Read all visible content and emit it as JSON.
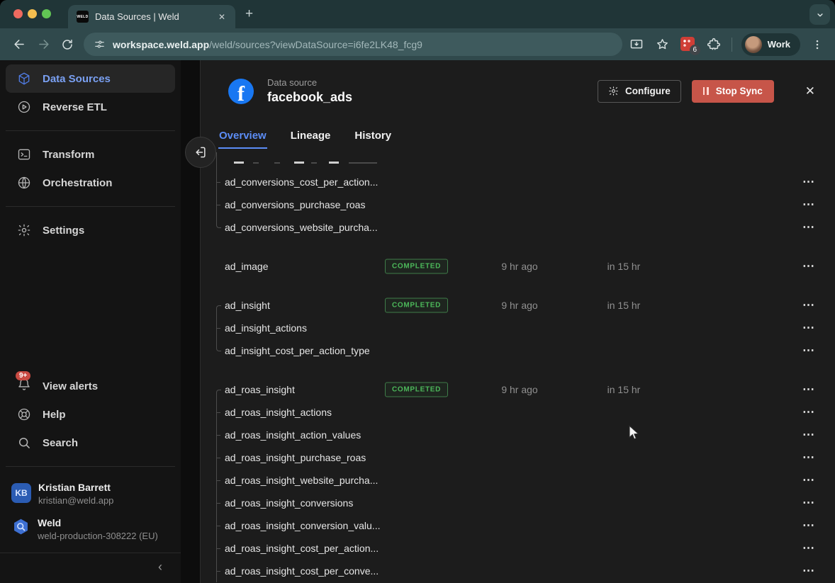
{
  "browser": {
    "tab": {
      "title": "Data Sources | Weld",
      "favicon": "WELD"
    },
    "url": {
      "host": "workspace.weld.app",
      "path": "/weld/sources?viewDataSource=i6fe2LK48_fcg9"
    },
    "profile": {
      "label": "Work"
    },
    "extension_badge": "6"
  },
  "sidebar": {
    "nav": [
      {
        "label": "Data Sources",
        "icon": "cube-icon",
        "active": true
      },
      {
        "label": "Reverse ETL",
        "icon": "play-circle-icon"
      },
      {
        "label": "Transform",
        "icon": "terminal-icon"
      },
      {
        "label": "Orchestration",
        "icon": "globe-icon"
      },
      {
        "label": "Settings",
        "icon": "gear-icon"
      }
    ],
    "utility": [
      {
        "label": "View alerts",
        "icon": "bell-icon",
        "badge": "9+"
      },
      {
        "label": "Help",
        "icon": "lifebuoy-icon"
      },
      {
        "label": "Search",
        "icon": "search-icon"
      }
    ],
    "user": {
      "initials": "KB",
      "name": "Kristian Barrett",
      "email": "kristian@weld.app"
    },
    "workspace": {
      "name": "Weld",
      "detail": "weld-production-308222 (EU)"
    }
  },
  "panel": {
    "kicker": "Data source",
    "title": "facebook_ads",
    "buttons": {
      "configure": "Configure",
      "stop_sync": "Stop Sync"
    },
    "tabs": [
      {
        "label": "Overview",
        "active": true
      },
      {
        "label": "Lineage"
      },
      {
        "label": "History"
      }
    ],
    "table_groups": [
      {
        "clipped_partial_row": true,
        "rows": [
          {
            "name": "ad_conversions_cost_per_action...",
            "tree": "mid"
          },
          {
            "name": "ad_conversions_purchase_roas",
            "tree": "mid"
          },
          {
            "name": "ad_conversions_website_purcha...",
            "tree": "last"
          }
        ]
      },
      {
        "rows": [
          {
            "name": "ad_image",
            "status": "COMPLETED",
            "last": "9 hr ago",
            "next": "in 15 hr",
            "tree": "none"
          }
        ]
      },
      {
        "rows": [
          {
            "name": "ad_insight",
            "status": "COMPLETED",
            "last": "9 hr ago",
            "next": "in 15 hr",
            "tree": "parent"
          },
          {
            "name": "ad_insight_actions",
            "tree": "mid"
          },
          {
            "name": "ad_insight_cost_per_action_type",
            "tree": "last"
          }
        ]
      },
      {
        "rows": [
          {
            "name": "ad_roas_insight",
            "status": "COMPLETED",
            "last": "9 hr ago",
            "next": "in 15 hr",
            "tree": "parent"
          },
          {
            "name": "ad_roas_insight_actions",
            "tree": "mid"
          },
          {
            "name": "ad_roas_insight_action_values",
            "tree": "mid"
          },
          {
            "name": "ad_roas_insight_purchase_roas",
            "tree": "mid"
          },
          {
            "name": "ad_roas_insight_website_purcha...",
            "tree": "mid"
          },
          {
            "name": "ad_roas_insight_conversions",
            "tree": "mid"
          },
          {
            "name": "ad_roas_insight_conversion_valu...",
            "tree": "mid"
          },
          {
            "name": "ad_roas_insight_cost_per_action...",
            "tree": "mid"
          },
          {
            "name": "ad_roas_insight_cost_per_conve...",
            "tree": "mid"
          }
        ]
      }
    ]
  },
  "icons": {
    "row_menu": "⋯",
    "close": "✕",
    "new_tab": "+",
    "collapse": "‹"
  },
  "colors": {
    "accent_blue": "#5c8df6",
    "status_green": "#4cb85a",
    "danger_red": "#c75549",
    "facebook_blue": "#1877f2",
    "badge_red": "#c94a42"
  }
}
